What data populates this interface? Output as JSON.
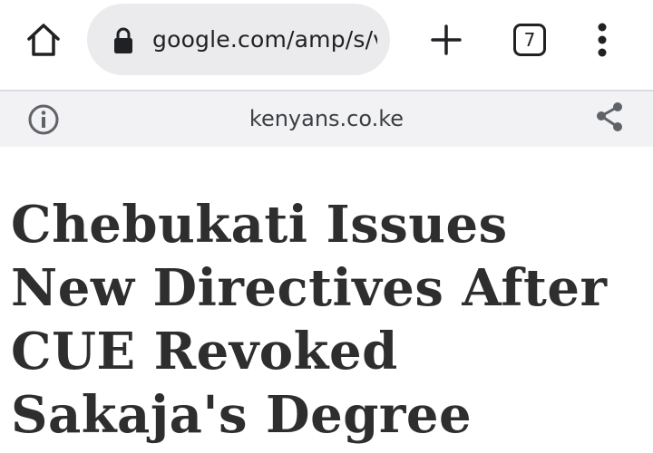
{
  "toolbar": {
    "url": "google.com/amp/s/v",
    "tab_count": "7"
  },
  "infobar": {
    "domain": "kenyans.co.ke"
  },
  "article": {
    "headline": "Chebukati Issues New Directives After CUE Revoked Sakaja's Degree"
  },
  "colors": {
    "omnibox_bg": "#ebebed",
    "infobar_bg": "#f2f2f4",
    "headline_text": "#2e2e2e"
  },
  "icons": [
    "home-icon",
    "lock-icon",
    "plus-icon",
    "tab-switcher-icon",
    "more-vert-icon",
    "info-icon",
    "share-icon"
  ]
}
